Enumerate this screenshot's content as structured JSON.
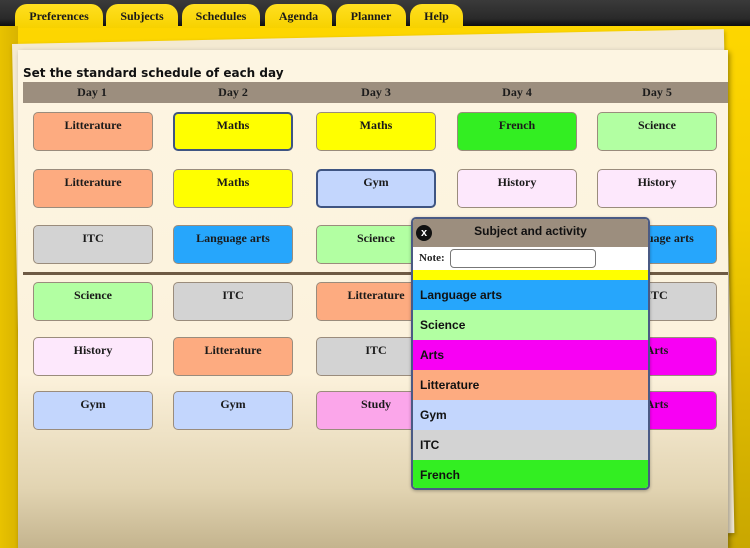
{
  "tabs": [
    {
      "label": "Preferences"
    },
    {
      "label": "Subjects"
    },
    {
      "label": "Schedules",
      "active": true
    },
    {
      "label": "Agenda"
    },
    {
      "label": "Planner"
    },
    {
      "label": "Help"
    }
  ],
  "page": {
    "title": "Set the standard schedule of each day"
  },
  "days": [
    "Day 1",
    "Day 2",
    "Day 3",
    "Day 4",
    "Day 5"
  ],
  "colors": {
    "Litterature": "#fdab80",
    "Maths": "#ffff00",
    "French": "#33ee22",
    "Science": "#b2ffa2",
    "History": "#fde8fc",
    "Gym": "#c3d6fd",
    "ITC": "#d3d3d3",
    "Language arts": "#26a6fc",
    "Study": "#fba6ea",
    "Arts": "#f800f4"
  },
  "schedule": {
    "rows_before_divider": [
      [
        "Litterature",
        "Maths",
        "Maths",
        "French",
        "Science"
      ],
      [
        "Litterature",
        "Maths",
        "Gym",
        "History",
        "History"
      ],
      [
        "ITC",
        "Language arts",
        "Science",
        "",
        "Language arts"
      ]
    ],
    "rows_after_divider": [
      [
        "Science",
        "ITC",
        "Litterature",
        "",
        "ITC"
      ],
      [
        "History",
        "Litterature",
        "ITC",
        "",
        "Arts"
      ],
      [
        "Gym",
        "Gym",
        "Study",
        "",
        "Arts"
      ]
    ],
    "selected_cells": [
      [
        0,
        1
      ],
      [
        1,
        2
      ]
    ]
  },
  "popup": {
    "title": "Subject and activity",
    "close_icon": "x-circle-icon",
    "close_glyph": "x",
    "note_label": "Note:",
    "note_value": "",
    "note_placeholder": "",
    "options": [
      {
        "label": "",
        "color": "#ffff00",
        "partial": true
      },
      {
        "label": "Language arts",
        "color": "#26a6fc"
      },
      {
        "label": "Science",
        "color": "#b2ffa2"
      },
      {
        "label": "Arts",
        "color": "#f800f4"
      },
      {
        "label": "Litterature",
        "color": "#fdab80"
      },
      {
        "label": "Gym",
        "color": "#c3d6fd"
      },
      {
        "label": "ITC",
        "color": "#d3d3d3"
      },
      {
        "label": "French",
        "color": "#33ee22"
      }
    ]
  }
}
